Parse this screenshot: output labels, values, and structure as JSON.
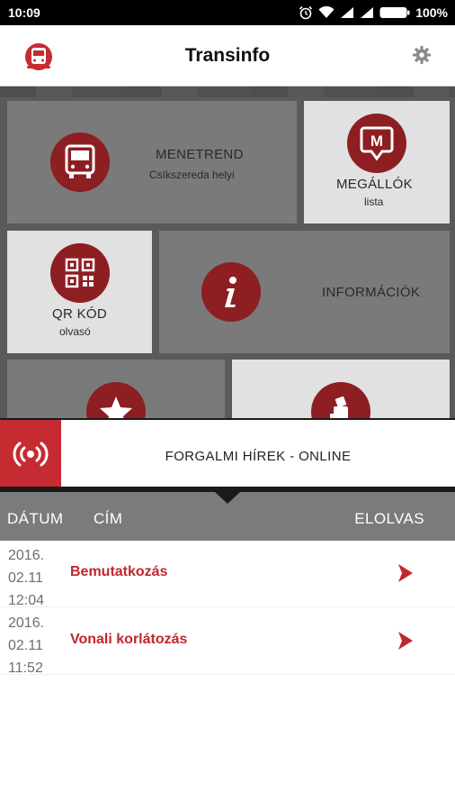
{
  "status_bar": {
    "time": "10:09",
    "battery": "100%",
    "icons": [
      "alarm-icon",
      "wifi-icon",
      "signal-icon",
      "signal-icon",
      "battery-icon"
    ]
  },
  "app_bar": {
    "title": "Transinfo",
    "logo_icon": "bus-logo-icon",
    "settings_icon": "gear-icon"
  },
  "tiles": {
    "menetrend": {
      "label": "MENETREND",
      "sublabel": "Csíkszereda helyi",
      "icon": "bus-icon"
    },
    "megallok": {
      "label": "MEGÁLLÓK",
      "sublabel": "lista",
      "icon": "map-pin-m-icon"
    },
    "qr": {
      "label": "QR KÓD",
      "sublabel": "olvasó",
      "icon": "qr-code-icon"
    },
    "informaciok": {
      "label": "INFORMÁCIÓK",
      "icon": "info-icon"
    },
    "favorites": {
      "icon": "star-icon"
    },
    "ticket": {
      "icon": "ticket-machine-icon"
    }
  },
  "news": {
    "title": "FORGALMI HÍREK - ONLINE",
    "icon": "broadcast-icon"
  },
  "table": {
    "headers": {
      "date": "DÁTUM",
      "title": "CÍM",
      "read": "ELOLVAS"
    },
    "rows": [
      {
        "date_line1": "2016.",
        "date_line2": "02.11",
        "date_line3": "12:04",
        "title": "Bemutatkozás"
      },
      {
        "date_line1": "2016.",
        "date_line2": "02.11",
        "date_line3": "11:52",
        "title": "Vonali korlátozás"
      }
    ]
  },
  "colors": {
    "brand_red": "#c62b32",
    "tile_circle": "#8d1e22",
    "header_gray": "#7b7b7b"
  }
}
